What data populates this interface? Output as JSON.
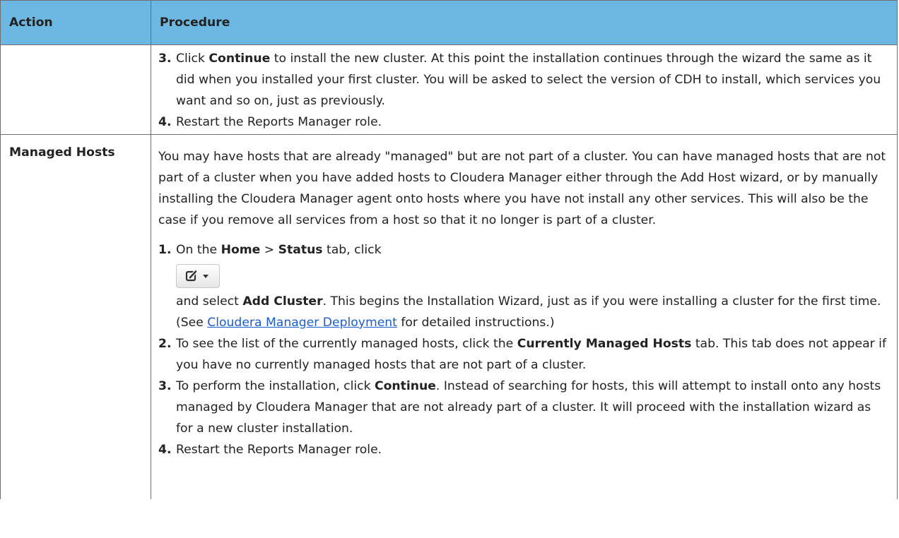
{
  "header": {
    "action": "Action",
    "procedure": "Procedure"
  },
  "rows": [
    {
      "action": "",
      "steps": [
        {
          "num": "3.",
          "pre": "Click ",
          "bold": "Continue",
          "post": " to install the new cluster. At this point the installation continues through the wizard the same as it did when you installed your first cluster. You will be asked to select the version of CDH to install, which services you want and so on, just as previously."
        },
        {
          "num": "4.",
          "text": "Restart the Reports Manager role."
        }
      ]
    },
    {
      "action": "Managed Hosts",
      "intro": "You may have hosts that are already \"managed\" but are not part of a cluster. You can have managed hosts that are not part of a cluster when you have added hosts to Cloudera Manager either through the Add Host wizard, or by manually installing the Cloudera Manager agent onto hosts where you have not install any other services. This will also be the case if you remove all services from a host so that it no longer is part of a cluster.",
      "step1": {
        "num": "1.",
        "t1": "On the ",
        "b1": "Home",
        "t2": " > ",
        "b2": "Status",
        "t3": " tab, click",
        "t4": "and select ",
        "b3": "Add Cluster",
        "t5": ". This begins the Installation Wizard, just as if you were installing a cluster for the first time. (See ",
        "link": "Cloudera Manager Deployment",
        "t6": " for detailed instructions.)"
      },
      "step2": {
        "num": "2.",
        "t1": "To see the list of the currently managed hosts, click the  ",
        "b1": "Currently Managed Hosts",
        "t2": " tab. This tab does not appear if you have no currently managed hosts that are not part of a cluster."
      },
      "step3": {
        "num": "3.",
        "t1": "To perform the installation, click ",
        "b1": "Continue",
        "t2": ". Instead of searching for hosts, this will attempt to install onto any hosts managed by Cloudera Manager that are not already part of a cluster. It will proceed with the installation wizard as for a new cluster installation."
      },
      "step4": {
        "num": "4.",
        "text": "Restart the Reports Manager role."
      }
    }
  ],
  "icons": {
    "edit_button": "edit-dropdown-icon"
  }
}
